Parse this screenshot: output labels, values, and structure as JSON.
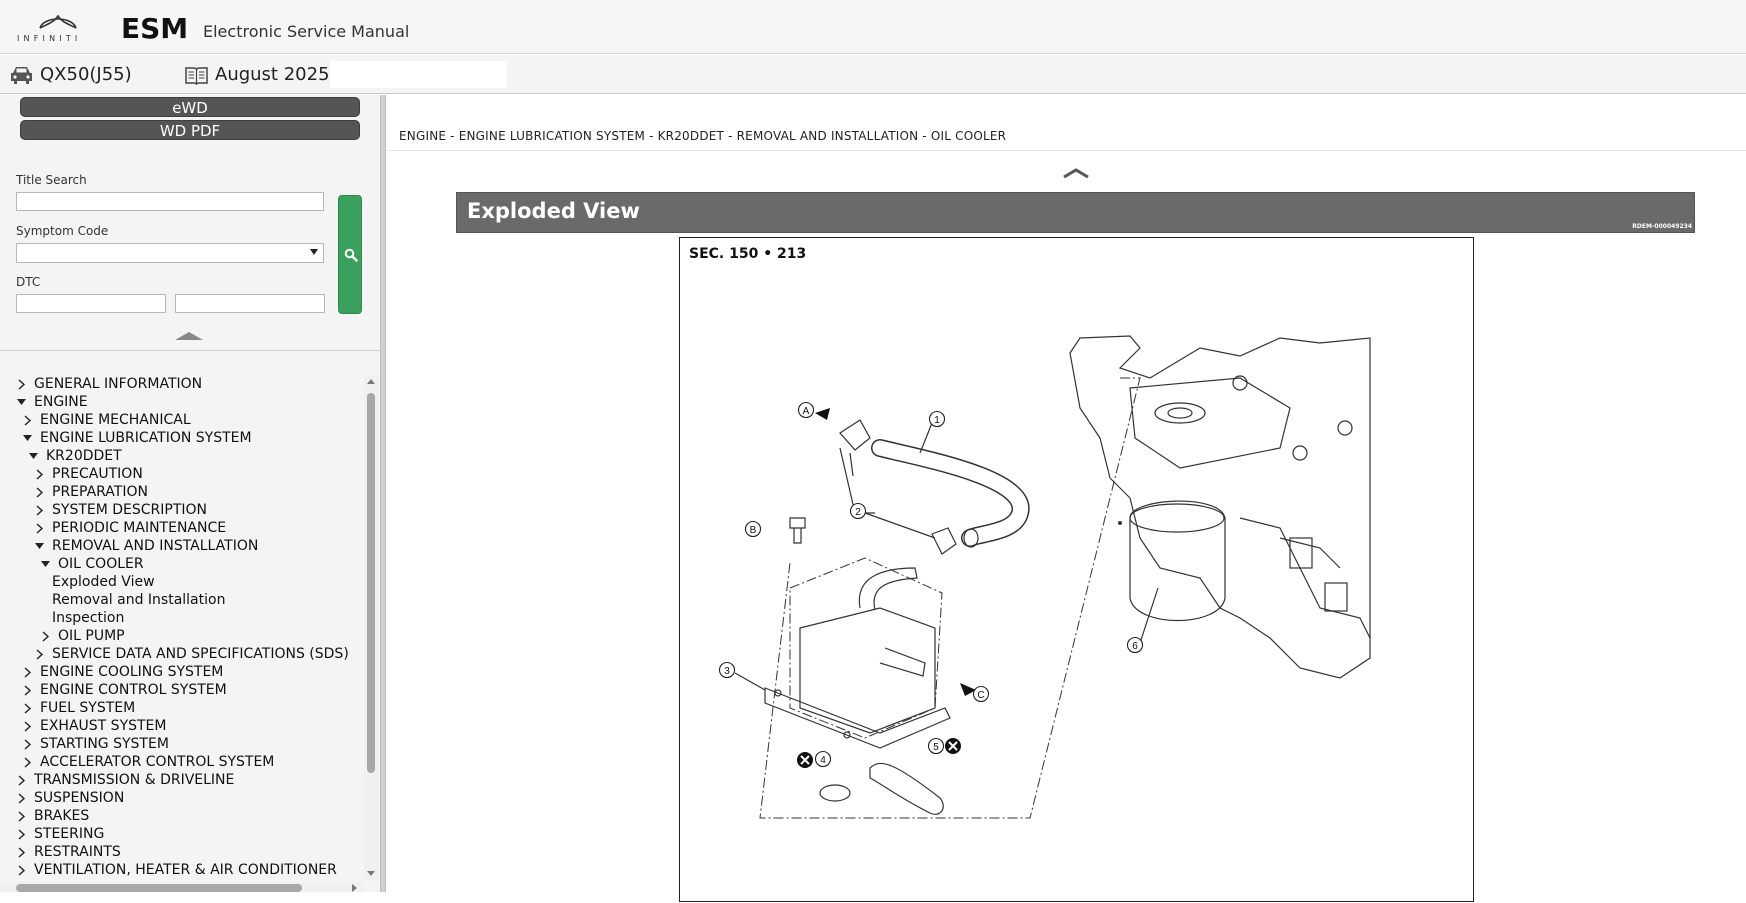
{
  "app": {
    "brand": "INFINITI",
    "title": "ESM",
    "subtitle": "Electronic Service Manual",
    "model": "QX50(J55)",
    "edition": "August 2025"
  },
  "sidebar": {
    "buttons": [
      "eWD",
      "WD PDF"
    ],
    "title_search_label": "Title Search",
    "symptom_code_label": "Symptom Code",
    "dtc_label": "DTC",
    "tree": [
      {
        "label": "GENERAL INFORMATION",
        "level": 0,
        "state": "collapsed"
      },
      {
        "label": "ENGINE",
        "level": 0,
        "state": "expanded"
      },
      {
        "label": "ENGINE MECHANICAL",
        "level": 1,
        "state": "collapsed"
      },
      {
        "label": "ENGINE LUBRICATION SYSTEM",
        "level": 1,
        "state": "expanded"
      },
      {
        "label": "KR20DDET",
        "level": 2,
        "state": "expanded"
      },
      {
        "label": "PRECAUTION",
        "level": 3,
        "state": "collapsed"
      },
      {
        "label": "PREPARATION",
        "level": 3,
        "state": "collapsed"
      },
      {
        "label": "SYSTEM DESCRIPTION",
        "level": 3,
        "state": "collapsed"
      },
      {
        "label": "PERIODIC MAINTENANCE",
        "level": 3,
        "state": "collapsed"
      },
      {
        "label": "REMOVAL AND INSTALLATION",
        "level": 3,
        "state": "expanded"
      },
      {
        "label": "OIL COOLER",
        "level": 4,
        "state": "expanded"
      },
      {
        "label": "Exploded View",
        "level": 5,
        "state": "leaf"
      },
      {
        "label": "Removal and Installation",
        "level": 5,
        "state": "leaf"
      },
      {
        "label": "Inspection",
        "level": 5,
        "state": "leaf"
      },
      {
        "label": "OIL PUMP",
        "level": 4,
        "state": "collapsed"
      },
      {
        "label": "SERVICE DATA AND SPECIFICATIONS (SDS)",
        "level": 3,
        "state": "collapsed"
      },
      {
        "label": "ENGINE COOLING SYSTEM",
        "level": 1,
        "state": "collapsed"
      },
      {
        "label": "ENGINE CONTROL SYSTEM",
        "level": 1,
        "state": "collapsed"
      },
      {
        "label": "FUEL SYSTEM",
        "level": 1,
        "state": "collapsed"
      },
      {
        "label": "EXHAUST SYSTEM",
        "level": 1,
        "state": "collapsed"
      },
      {
        "label": "STARTING SYSTEM",
        "level": 1,
        "state": "collapsed"
      },
      {
        "label": "ACCELERATOR CONTROL SYSTEM",
        "level": 1,
        "state": "collapsed"
      },
      {
        "label": "TRANSMISSION & DRIVELINE",
        "level": 0,
        "state": "collapsed"
      },
      {
        "label": "SUSPENSION",
        "level": 0,
        "state": "collapsed"
      },
      {
        "label": "BRAKES",
        "level": 0,
        "state": "collapsed"
      },
      {
        "label": "STEERING",
        "level": 0,
        "state": "collapsed"
      },
      {
        "label": "RESTRAINTS",
        "level": 0,
        "state": "collapsed"
      },
      {
        "label": "VENTILATION, HEATER & AIR CONDITIONER",
        "level": 0,
        "state": "collapsed"
      }
    ]
  },
  "main": {
    "breadcrumb": "ENGINE - ENGINE LUBRICATION SYSTEM - KR20DDET - REMOVAL AND INSTALLATION - OIL COOLER",
    "section_title": "Exploded View",
    "section_code": "RDEM-000049234",
    "figure": {
      "caption": "SEC. 150 • 213",
      "callouts": [
        "1",
        "2",
        "3",
        "4",
        "5",
        "6",
        "A",
        "B",
        "C"
      ]
    }
  },
  "colors": {
    "section_bar": "#6a6a6a",
    "search_button": "#3aa05e",
    "dark_button": "#555555",
    "sidebar_bg": "#f4f4f4"
  }
}
